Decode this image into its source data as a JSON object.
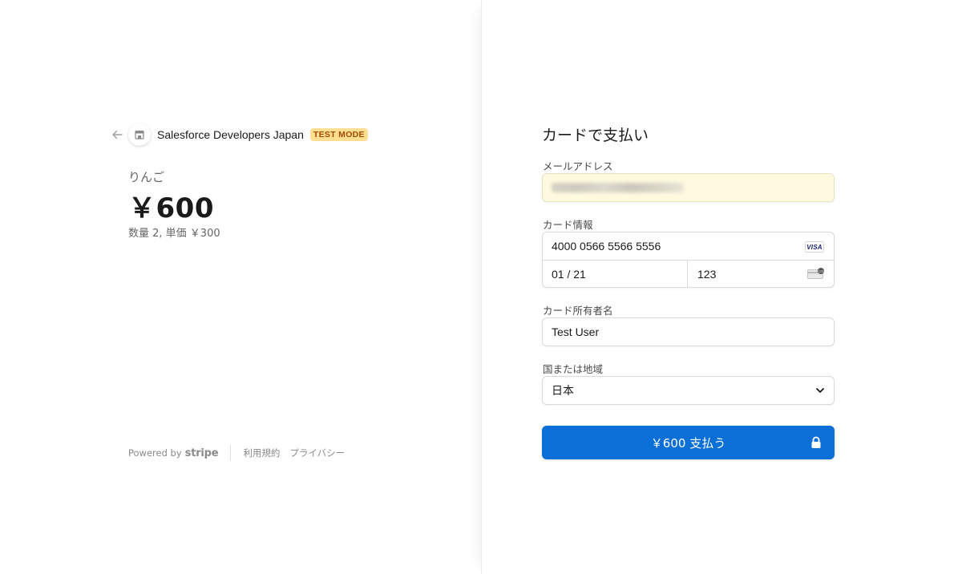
{
  "merchant": {
    "name": "Salesforce Developers Japan",
    "badge": "TEST MODE"
  },
  "product": {
    "name": "りんご",
    "price": "￥600",
    "quantity_line": "数量 2, 単価 ￥300"
  },
  "footer": {
    "powered_by": "Powered by",
    "brand": "stripe",
    "terms": "利用規約",
    "privacy": "プライバシー"
  },
  "form": {
    "title": "カードで支払い",
    "email": {
      "label": "メールアドレス"
    },
    "card": {
      "label": "カード情報",
      "number": "4000 0566 5566 5556",
      "brand_icon": "VISA",
      "expiry": "01 / 21",
      "cvc": "123",
      "cvc_icon_text": "123"
    },
    "holder": {
      "label": "カード所有者名",
      "value": "Test User"
    },
    "country": {
      "label": "国または地域",
      "value": "日本"
    },
    "pay_button": "￥600 支払う"
  },
  "colors": {
    "accent": "#0a6fd6",
    "badge_bg": "#ffde92",
    "badge_text": "#a04a00",
    "email_autofill_bg": "#fefae0"
  }
}
